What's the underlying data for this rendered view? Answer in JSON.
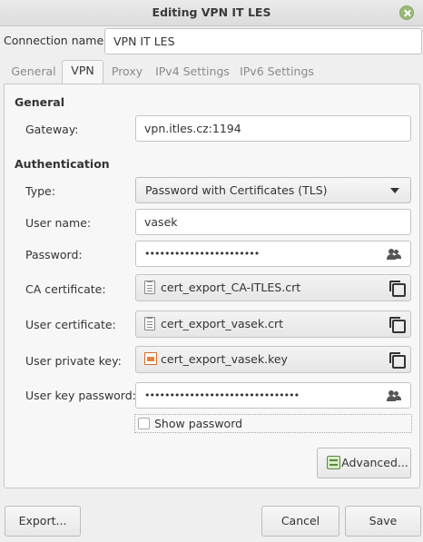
{
  "window": {
    "title": "Editing VPN IT LES"
  },
  "connection": {
    "name_label": "Connection name:",
    "name_value": "VPN IT LES"
  },
  "tabs": [
    {
      "label": "General"
    },
    {
      "label": "VPN"
    },
    {
      "label": "Proxy"
    },
    {
      "label": "IPv4 Settings"
    },
    {
      "label": "IPv6 Settings"
    }
  ],
  "general": {
    "section_title": "General",
    "gateway_label": "Gateway:",
    "gateway_value": "vpn.itles.cz:1194"
  },
  "authentication": {
    "section_title": "Authentication",
    "type_label": "Type:",
    "type_value": "Password with Certificates (TLS)",
    "username_label": "User name:",
    "username_value": "vasek",
    "password_label": "Password:",
    "password_value": "•••••••••••••••••••••••",
    "ca_cert_label": "CA certificate:",
    "ca_cert_value": "cert_export_CA-ITLES.crt",
    "user_cert_label": "User certificate:",
    "user_cert_value": "cert_export_vasek.crt",
    "user_key_label": "User private key:",
    "user_key_value": "cert_export_vasek.key",
    "key_password_label": "User key password:",
    "key_password_value": "•••••••••••••••••••••••••••••••",
    "show_password_label": "Show password"
  },
  "buttons": {
    "advanced": "Advanced...",
    "export": "Export...",
    "cancel": "Cancel",
    "save": "Save"
  }
}
